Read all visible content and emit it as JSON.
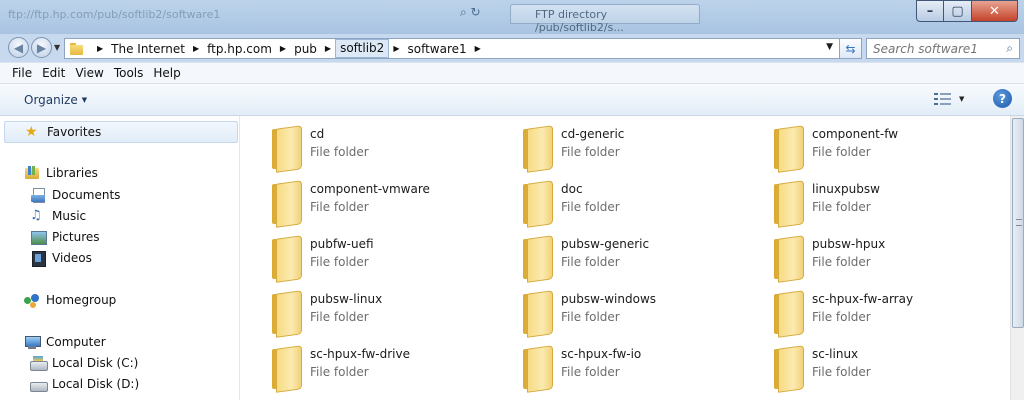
{
  "window": {
    "background_text": "ftp://ftp.hp.com/pub/softlib2/software1",
    "background_tab": "FTP directory /pub/softlib2/s..."
  },
  "address": {
    "crumbs": [
      "The Internet",
      "ftp.hp.com",
      "pub",
      "softlib2",
      "software1"
    ]
  },
  "search": {
    "placeholder": "Search software1"
  },
  "menu": [
    "File",
    "Edit",
    "View",
    "Tools",
    "Help"
  ],
  "toolbar": {
    "organize_label": "Organize"
  },
  "nav": {
    "favorites": "Favorites",
    "libraries": "Libraries",
    "documents": "Documents",
    "music": "Music",
    "pictures": "Pictures",
    "videos": "Videos",
    "homegroup": "Homegroup",
    "computer": "Computer",
    "disk_c": "Local Disk (C:)",
    "disk_d": "Local Disk (D:)"
  },
  "items": [
    {
      "name": "cd",
      "type": "File folder"
    },
    {
      "name": "cd-generic",
      "type": "File folder"
    },
    {
      "name": "component-fw",
      "type": "File folder"
    },
    {
      "name": "component-vmware",
      "type": "File folder"
    },
    {
      "name": "doc",
      "type": "File folder"
    },
    {
      "name": "linuxpubsw",
      "type": "File folder"
    },
    {
      "name": "pubfw-uefi",
      "type": "File folder"
    },
    {
      "name": "pubsw-generic",
      "type": "File folder"
    },
    {
      "name": "pubsw-hpux",
      "type": "File folder"
    },
    {
      "name": "pubsw-linux",
      "type": "File folder"
    },
    {
      "name": "pubsw-windows",
      "type": "File folder"
    },
    {
      "name": "sc-hpux-fw-array",
      "type": "File folder"
    },
    {
      "name": "sc-hpux-fw-drive",
      "type": "File folder"
    },
    {
      "name": "sc-hpux-fw-io",
      "type": "File folder"
    },
    {
      "name": "sc-linux",
      "type": "File folder"
    }
  ],
  "icons": {
    "back": "back-arrow-icon",
    "forward": "forward-arrow-icon",
    "refresh": "refresh-icon",
    "search": "search-icon",
    "help": "help-icon",
    "views": "change-view-icon"
  }
}
